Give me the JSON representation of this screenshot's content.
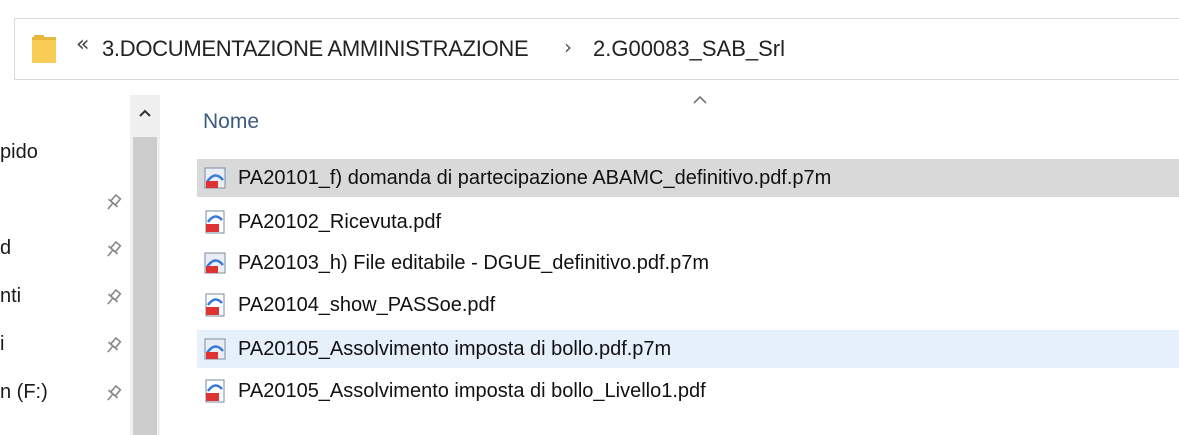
{
  "address_bar": {
    "overflow_glyph": "«",
    "separator": "›",
    "crumbs": [
      "3.DOCUMENTAZIONE AMMINISTRAZIONE",
      "2.G00083_SAB_Srl"
    ]
  },
  "nav_pane": {
    "items": [
      {
        "label": "pido",
        "pinned": false
      },
      {
        "label": "",
        "pinned": true
      },
      {
        "label": "d",
        "pinned": true
      },
      {
        "label": "nti",
        "pinned": true
      },
      {
        "label": "i",
        "pinned": true
      },
      {
        "label": "n (F:)",
        "pinned": true
      }
    ]
  },
  "file_list": {
    "column_header": "Nome",
    "sort": "ascending",
    "files": [
      {
        "name": "PA20101_f) domanda di partecipazione ABAMC_definitivo.pdf.p7m",
        "icon": "p7m-file-icon",
        "state": "selected"
      },
      {
        "name": "PA20102_Ricevuta.pdf",
        "icon": "pdf-file-icon",
        "state": "normal"
      },
      {
        "name": "PA20103_h) File editabile - DGUE_definitivo.pdf.p7m",
        "icon": "p7m-file-icon",
        "state": "normal"
      },
      {
        "name": "PA20104_show_PASSoe.pdf",
        "icon": "pdf-file-icon",
        "state": "normal"
      },
      {
        "name": "PA20105_Assolvimento imposta di bollo.pdf.p7m",
        "icon": "p7m-file-icon",
        "state": "hover"
      },
      {
        "name": "PA20105_Assolvimento imposta di bollo_Livello1.pdf",
        "icon": "pdf-file-icon",
        "state": "normal"
      }
    ]
  },
  "colors": {
    "selected_row": "#d9d9d9",
    "hover_row": "#e5f0fb",
    "header_text": "#3c5a80",
    "folder": "#f5c542"
  }
}
